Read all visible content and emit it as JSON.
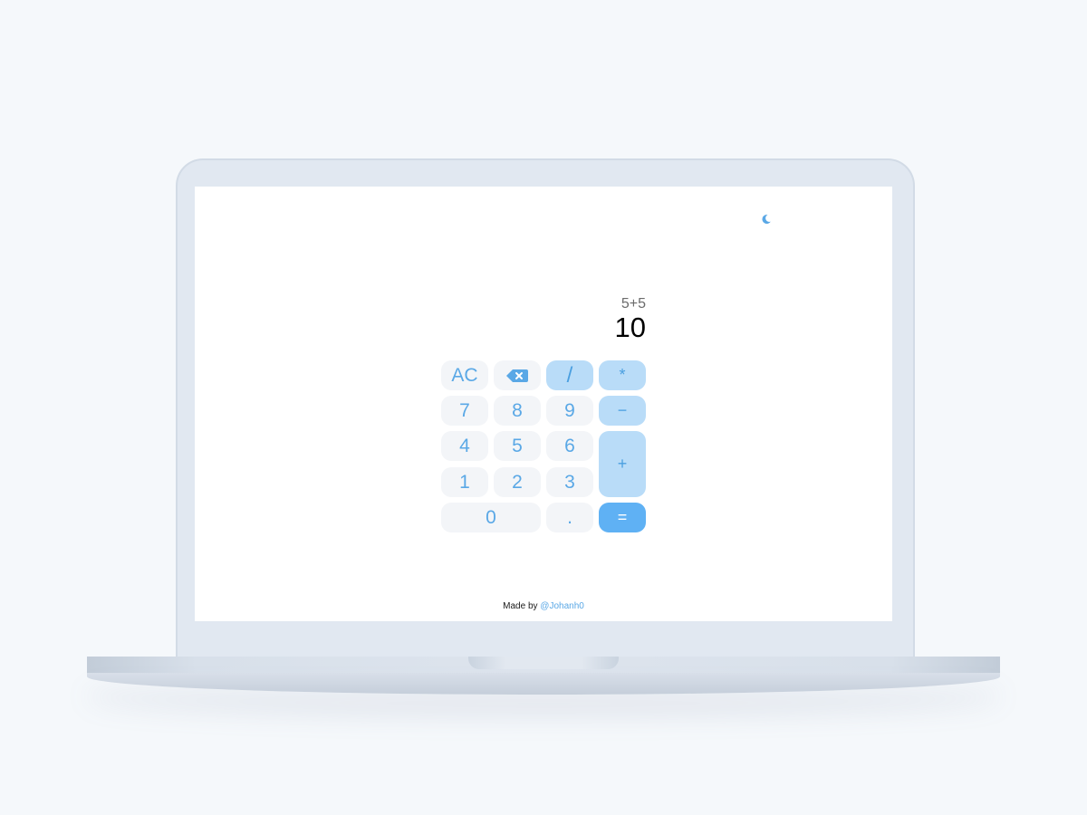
{
  "calculator": {
    "expression": "5+5",
    "result": "10",
    "keys": {
      "clear": "AC",
      "divide": "/",
      "multiply": "*",
      "seven": "7",
      "eight": "8",
      "nine": "9",
      "minus": "−",
      "four": "4",
      "five": "5",
      "six": "6",
      "plus": "+",
      "one": "1",
      "two": "2",
      "three": "3",
      "zero": "0",
      "decimal": ".",
      "equals": "="
    },
    "icons": {
      "backspace": "backspace-icon",
      "theme": "moon-icon"
    }
  },
  "footer": {
    "prefix": "Made by",
    "author": "@Johanh0"
  },
  "colors": {
    "accent": "#5aa8e6",
    "operator_bg": "#b9dcf8",
    "equals_bg": "#5fb1f4",
    "key_bg": "#f3f5f8"
  }
}
